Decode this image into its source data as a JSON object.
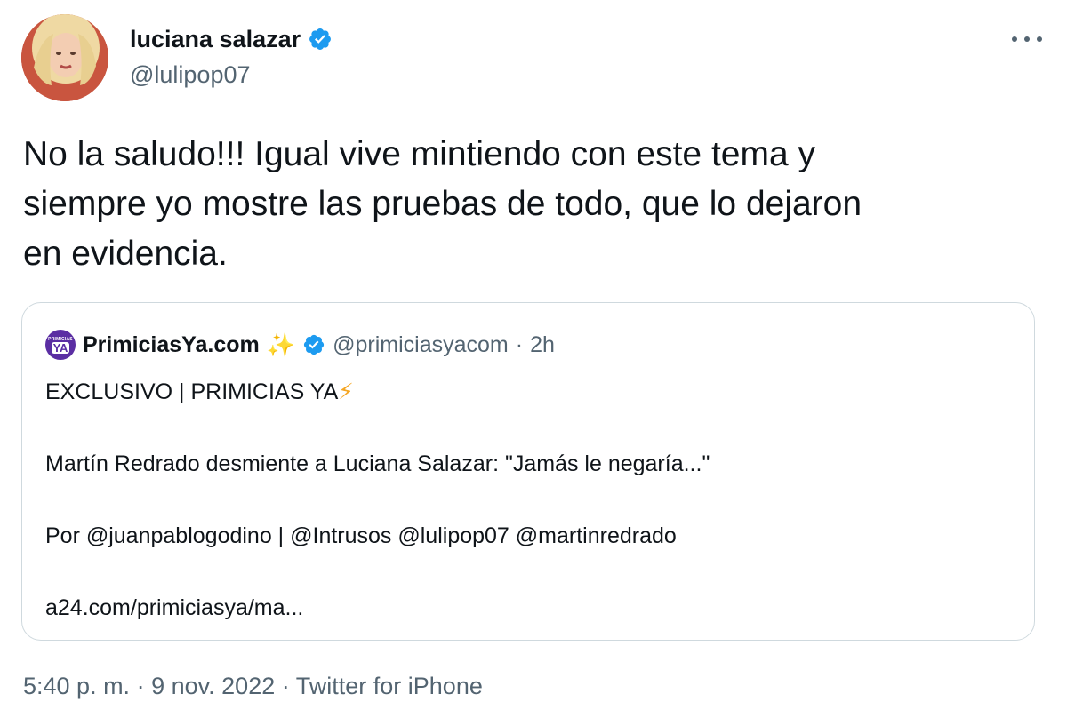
{
  "author": {
    "display_name": "luciana salazar",
    "handle": "@lulipop07",
    "verified": true,
    "avatar_icon": "profile-photo"
  },
  "tweet": {
    "text": "No la saludo!!! Igual vive mintiendo con este tema y\nsiempre yo mostre las pruebas de todo, que lo dejaron\nen evidencia."
  },
  "quoted_tweet": {
    "logo_small": "PRIMICIAS",
    "logo_big": "YA",
    "display_name": "PrimiciasYa.com",
    "emoji": "✨",
    "handle": "@primiciasyacom",
    "separator": "·",
    "time_ago": "2h",
    "lines": {
      "headline": "EXCLUSIVO | PRIMICIAS YA",
      "headline_emoji": "⚡",
      "title": "Martín Redrado desmiente a Luciana Salazar: \"Jamás le negaría...\"",
      "credits": "Por @juanpablogodino | @Intrusos @lulipop07 @martinredrado",
      "link": "a24.com/primiciasya/ma..."
    }
  },
  "footer": {
    "time": "5:40 p. m.",
    "sep1": "·",
    "date": "9 nov. 2022",
    "sep2": "·",
    "source": "Twitter for iPhone"
  },
  "colors": {
    "verified_blue": "#1d9bf0",
    "secondary_text": "#536471",
    "primary_text": "#0f1419",
    "border": "#cfd9de",
    "logo_purple": "#5b2ea3"
  }
}
